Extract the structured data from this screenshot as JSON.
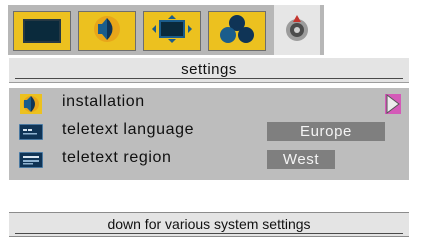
{
  "tabs": [
    {
      "icon": "screen-picture-icon"
    },
    {
      "icon": "speaker-sound-icon"
    },
    {
      "icon": "screen-format-icon"
    },
    {
      "icon": "features-icon"
    },
    {
      "icon": "settings-icon",
      "active": true
    }
  ],
  "header": {
    "title": "settings"
  },
  "menu": {
    "items": [
      {
        "icon": "installation-icon",
        "label": "installation",
        "arrow": "right-arrow-icon"
      },
      {
        "icon": "teletext-language-icon",
        "label": "teletext language",
        "value": "Europe"
      },
      {
        "icon": "teletext-region-icon",
        "label": "teletext region",
        "value": "West"
      }
    ]
  },
  "footer": {
    "hint": "down for various system settings"
  },
  "colors": {
    "tab_bg": "#ecc11f",
    "tab_active_bg": "#e6e6e6",
    "panel_bg": "#bdbdbd",
    "value_bg": "#7f7f7f",
    "arrow": "#d45ab8"
  }
}
